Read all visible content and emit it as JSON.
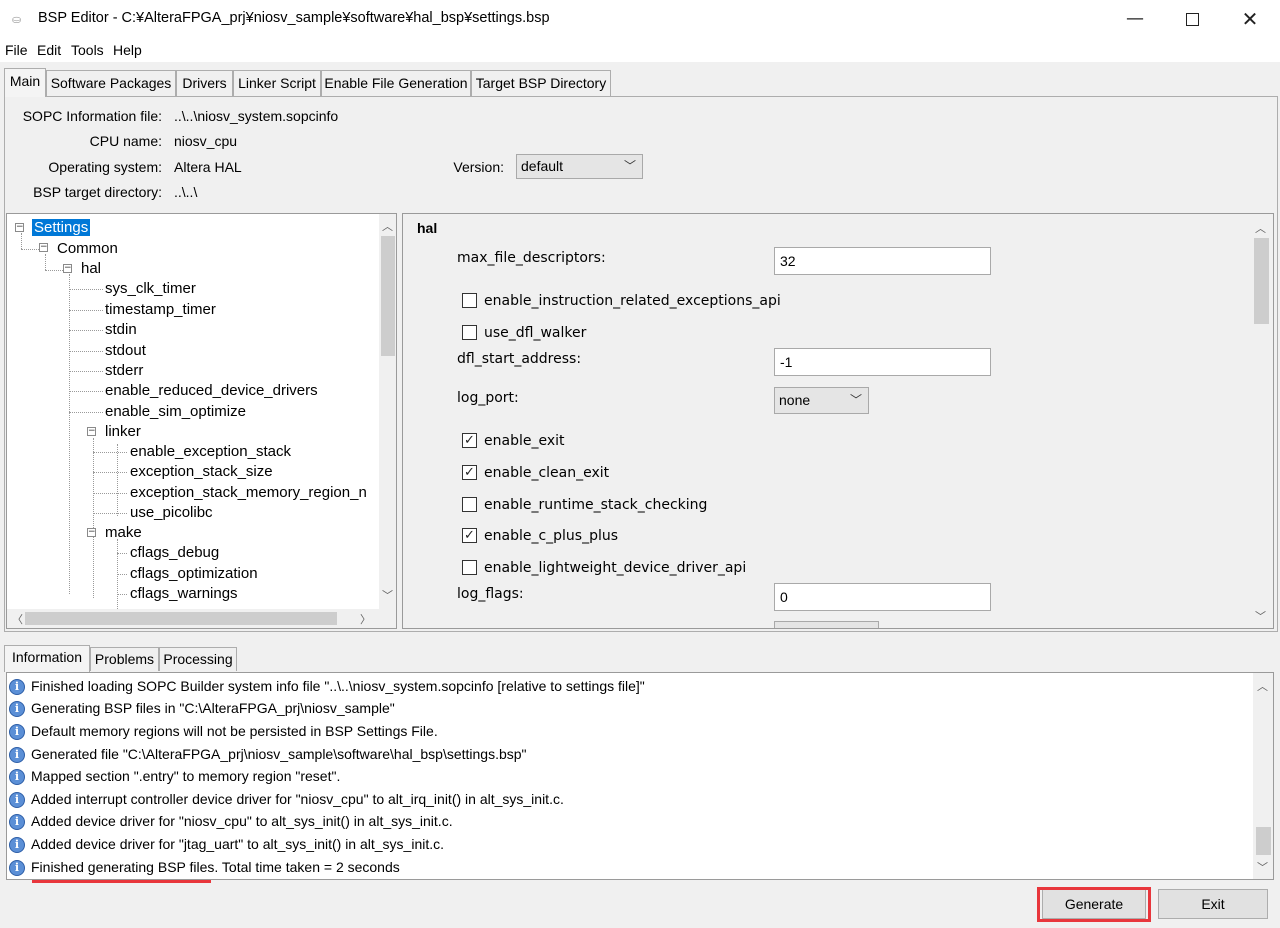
{
  "window": {
    "title": "BSP Editor - C:¥AlteraFPGA_prj¥niosv_sample¥software¥hal_bsp¥settings.bsp",
    "minimize": "—",
    "close": "✕"
  },
  "menu": [
    "File",
    "Edit",
    "Tools",
    "Help"
  ],
  "tabs": [
    "Main",
    "Software Packages",
    "Drivers",
    "Linker Script",
    "Enable File Generation",
    "Target BSP Directory"
  ],
  "info": {
    "sopc_label": "SOPC Information file:",
    "sopc_value": "..\\..\\niosv_system.sopcinfo",
    "cpu_label": "CPU name:",
    "cpu_value": "niosv_cpu",
    "os_label": "Operating system:",
    "os_value": "Altera HAL",
    "version_label": "Version:",
    "version_value": "default",
    "bsp_label": "BSP target directory:",
    "bsp_value": "..\\..\\"
  },
  "tree": {
    "root": "Settings",
    "common": "Common",
    "hal": "hal",
    "hal_children": [
      "sys_clk_timer",
      "timestamp_timer",
      "stdin",
      "stdout",
      "stderr",
      "enable_reduced_device_drivers",
      "enable_sim_optimize"
    ],
    "linker": "linker",
    "linker_children": [
      "enable_exception_stack",
      "exception_stack_size",
      "exception_stack_memory_region_n",
      "use_picolibc"
    ],
    "make": "make",
    "make_children": [
      "cflags_debug",
      "cflags_optimization",
      "cflags_warnings"
    ]
  },
  "settings": {
    "section": "hal",
    "max_file_descriptors_label": "max_file_descriptors:",
    "max_file_descriptors_value": "32",
    "enable_instruction_related_exceptions_api": "enable_instruction_related_exceptions_api",
    "use_dfl_walker": "use_dfl_walker",
    "dfl_start_address_label": "dfl_start_address:",
    "dfl_start_address_value": "-1",
    "log_port_label": "log_port:",
    "log_port_value": "none",
    "enable_exit": "enable_exit",
    "enable_clean_exit": "enable_clean_exit",
    "enable_runtime_stack_checking": "enable_runtime_stack_checking",
    "enable_c_plus_plus": "enable_c_plus_plus",
    "enable_lightweight_device_driver_api": "enable_lightweight_device_driver_api",
    "log_flags_label": "log_flags:",
    "log_flags_value": "0",
    "checked": {
      "enable_instruction_related_exceptions_api": false,
      "use_dfl_walker": false,
      "enable_exit": true,
      "enable_clean_exit": true,
      "enable_runtime_stack_checking": false,
      "enable_c_plus_plus": true,
      "enable_lightweight_device_driver_api": false
    }
  },
  "bottom_tabs": [
    "Information",
    "Problems",
    "Processing"
  ],
  "log": [
    "Finished loading SOPC Builder system info file \"..\\..\\niosv_system.sopcinfo [relative to settings file]\"",
    "Generating BSP files in \"C:\\AlteraFPGA_prj\\niosv_sample\"",
    "Default memory regions will not be persisted in BSP Settings File.",
    "Generated file \"C:\\AlteraFPGA_prj\\niosv_sample\\software\\hal_bsp\\settings.bsp\"",
    "Mapped section \".entry\" to memory region \"reset\".",
    "Added interrupt controller device driver for \"niosv_cpu\" to alt_irq_init() in alt_sys_init.c.",
    "Added device driver for \"niosv_cpu\" to alt_sys_init() in alt_sys_init.c.",
    "Added device driver for \"jtag_uart\" to alt_sys_init() in alt_sys_init.c.",
    "Finished generating BSP files. Total time taken = 2 seconds"
  ],
  "buttons": {
    "generate": "Generate",
    "exit": "Exit"
  },
  "colors": {
    "highlight": "#e8363c",
    "selection": "#0078d7",
    "info_icon": "#5b8fd6"
  }
}
